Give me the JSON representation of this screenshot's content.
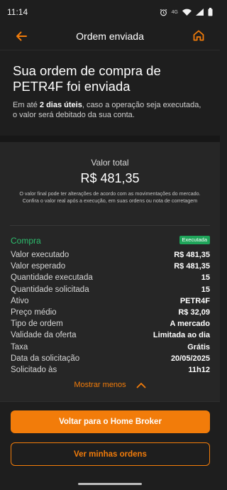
{
  "status_bar": {
    "time": "11:14",
    "network": "4G",
    "icons": [
      "alarm-icon",
      "wifi-icon",
      "signal-icon",
      "battery-icon"
    ]
  },
  "header": {
    "title": "Ordem enviada",
    "back_icon": "arrow-left-icon",
    "home_icon": "home-icon"
  },
  "hero": {
    "heading": "Sua ordem de compra de PETR4F foi enviada",
    "desc_prefix": "Em até ",
    "desc_bold": "2 dias úteis",
    "desc_suffix": ", caso a operação seja executada, o valor será debitado da sua conta."
  },
  "summary": {
    "total_label": "Valor total",
    "total_value": "R$ 481,35",
    "note": "O valor final pode ter alterações de acordo com as movimentações do mercado. Confira o valor real após a execução, em suas ordens ou nota de corretagem"
  },
  "order": {
    "section_title": "Compra",
    "status_badge": "Executada",
    "rows": [
      {
        "label": "Valor executado",
        "value": "R$ 481,35"
      },
      {
        "label": "Valor esperado",
        "value": "R$ 481,35"
      },
      {
        "label": "Quantidade executada",
        "value": "15"
      },
      {
        "label": "Quantidade solicitada",
        "value": "15"
      },
      {
        "label": "Ativo",
        "value": "PETR4F"
      },
      {
        "label": "Preço médio",
        "value": "R$ 32,09"
      },
      {
        "label": "Tipo de ordem",
        "value": "A mercado"
      },
      {
        "label": "Validade da oferta",
        "value": "Limitada ao dia"
      },
      {
        "label": "Taxa",
        "value": "Grátis"
      },
      {
        "label": "Data da solicitação",
        "value": "20/05/2025"
      },
      {
        "label": "Solicitado às",
        "value": "11h12"
      }
    ],
    "toggle_label": "Mostrar menos"
  },
  "actions": {
    "primary_label": "Voltar para o Home Broker",
    "secondary_label": "Ver minhas ordens"
  },
  "colors": {
    "accent": "#f27c0a",
    "success": "#2ebd6e",
    "background": "#1e1e1e",
    "card": "#262626"
  }
}
